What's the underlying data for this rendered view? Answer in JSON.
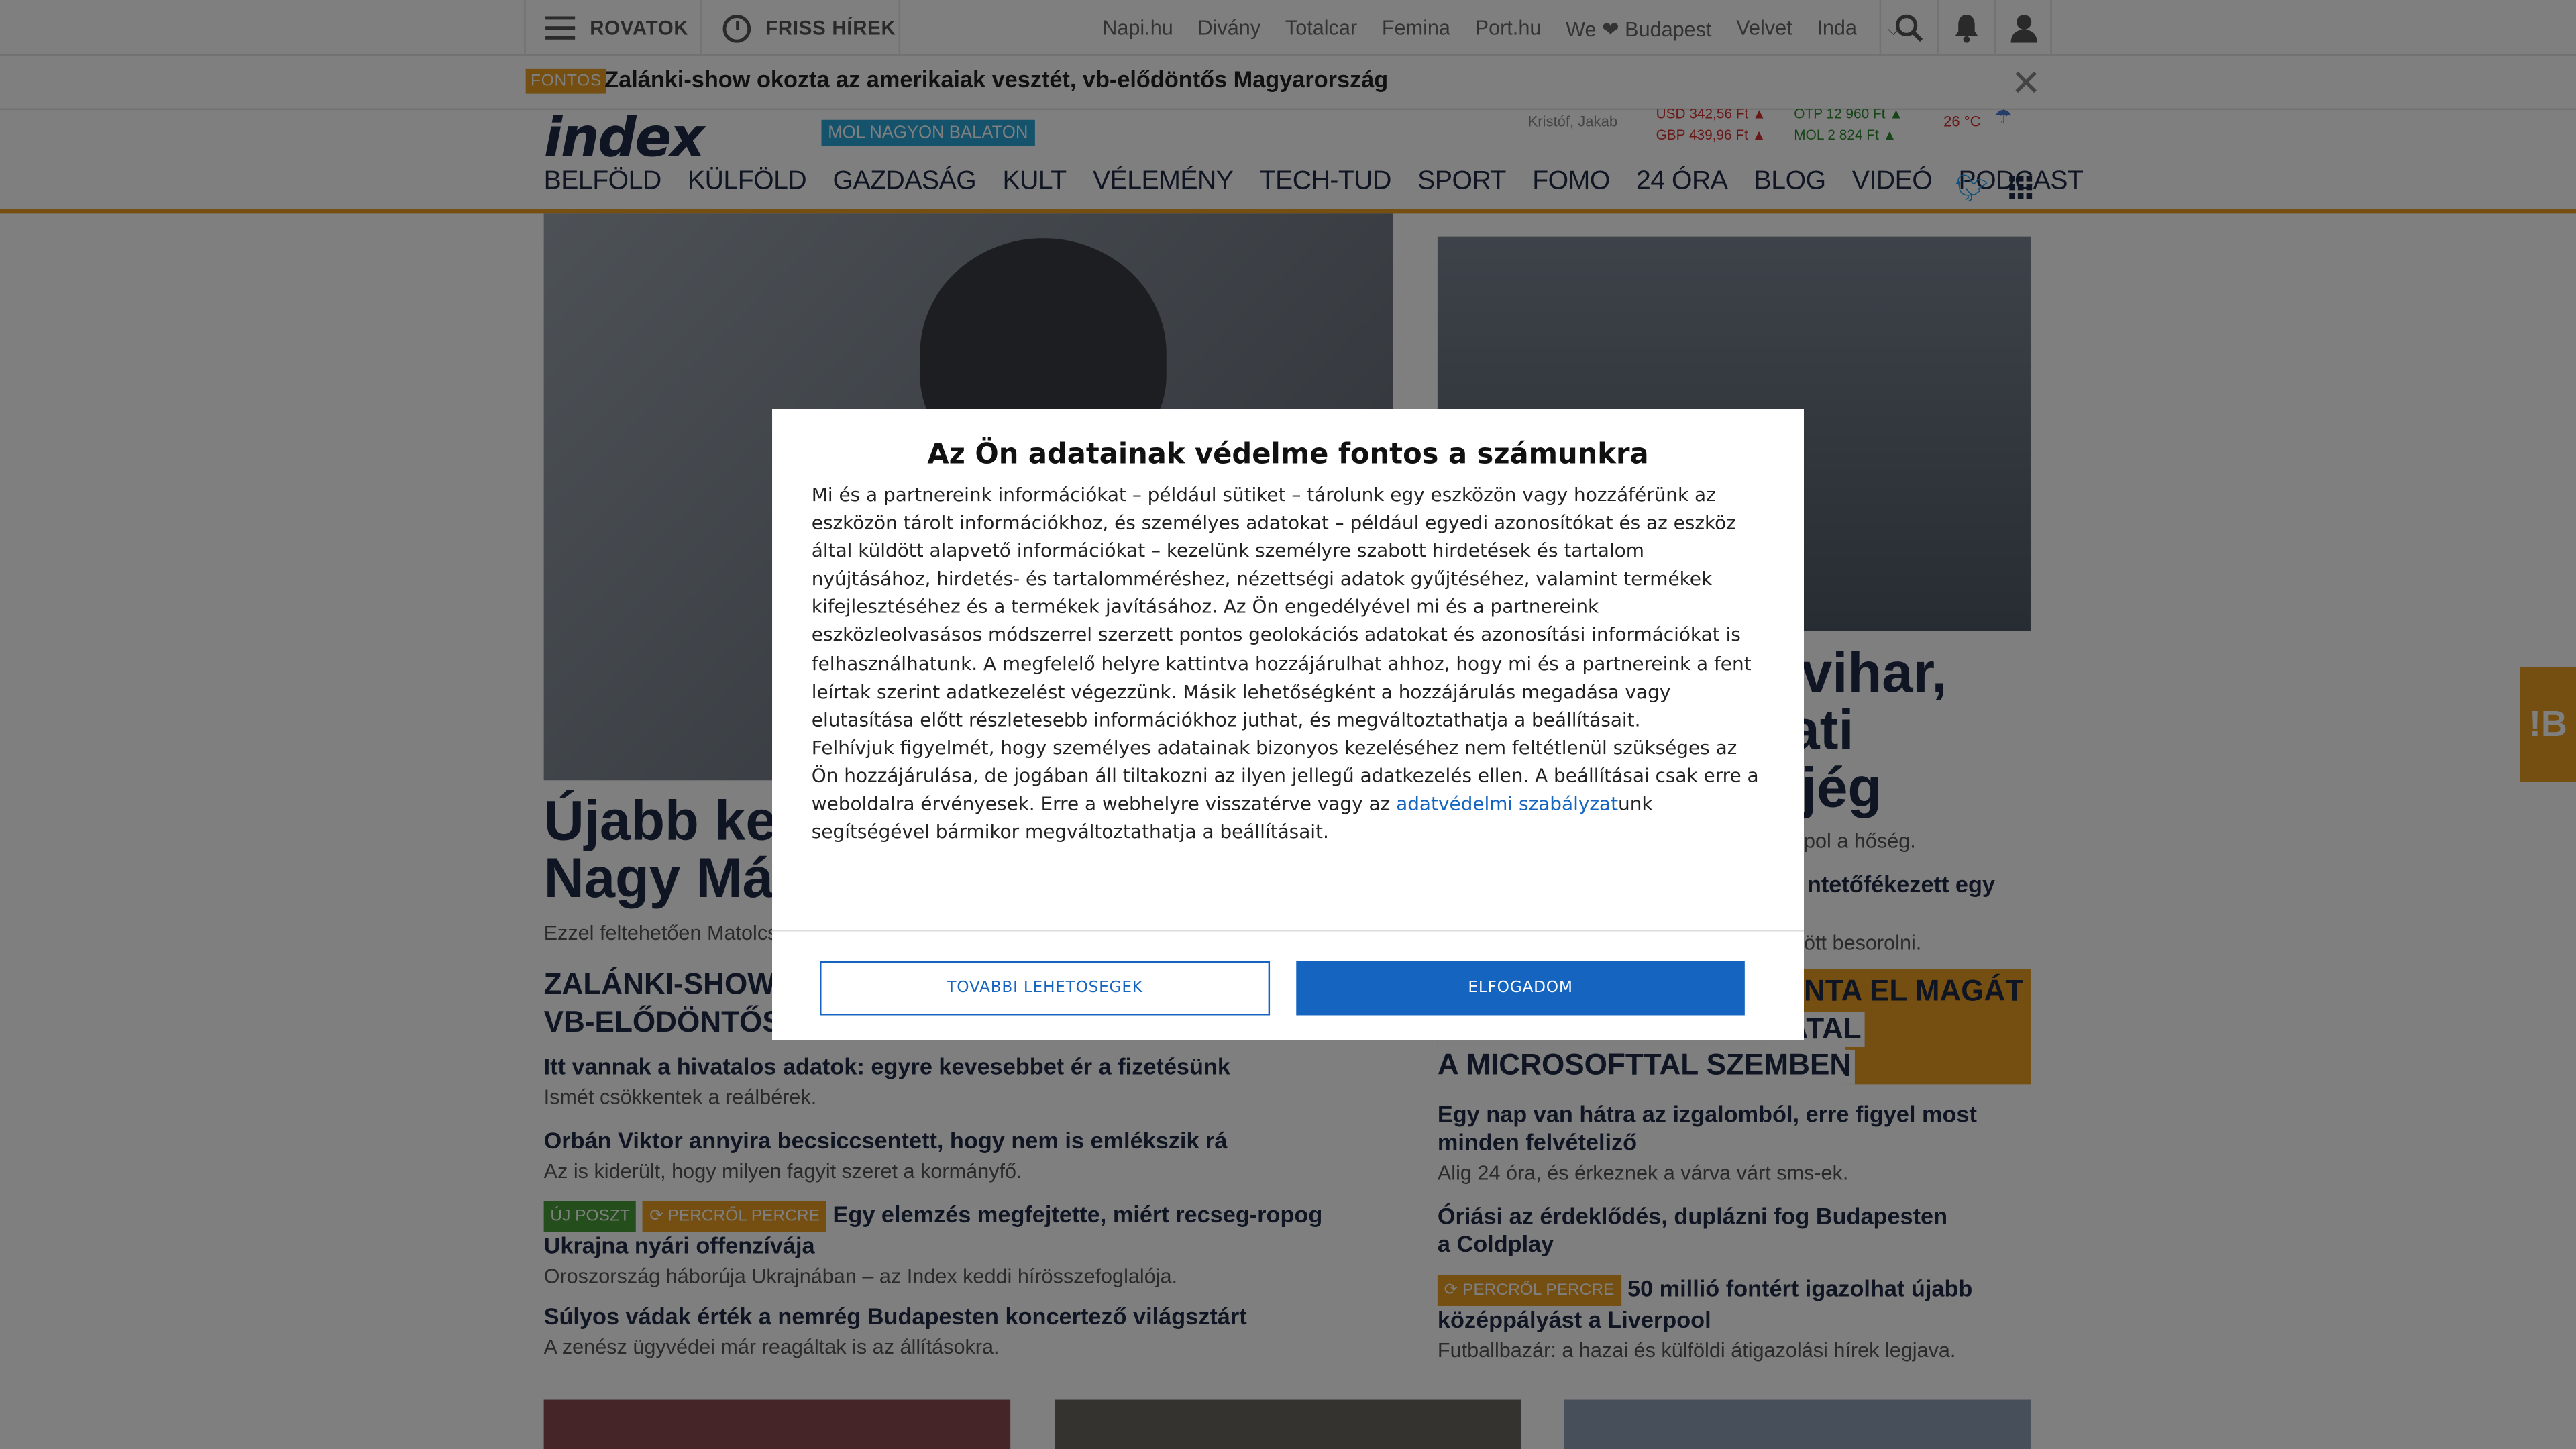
{
  "topbar": {
    "rovatok_label": "ROVATOK",
    "friss_label": "FRISS HÍREK",
    "sites": [
      "Napi.hu",
      "Divány",
      "Totalcar",
      "Femina",
      "Port.hu",
      "We ❤ Budapest",
      "Velvet",
      "Inda"
    ],
    "icons": [
      "search-icon",
      "bell-icon",
      "user-icon"
    ]
  },
  "breaking": {
    "badge": "FONTOS",
    "text": "Zalánki-show okozta az amerikaiak vesztét, vb-elődöntős Magyarország"
  },
  "header": {
    "logo": "index",
    "sponsor_badge": "MOL NAGYON BALATON",
    "author": "Kristóf, Jakab",
    "fx": {
      "usd": "USD 342,56 Ft",
      "gbp": "GBP 439,96 Ft",
      "utp": "OTP 12 960 Ft",
      "mol": "MOL 2 824 Ft"
    },
    "temperature": "26 °C"
  },
  "nav": {
    "items": [
      "BELFÖLD",
      "KÜLFÖLD",
      "GAZDASÁG",
      "KULT",
      "VÉLEMÉNY",
      "TECH-TUD",
      "SPORT",
      "FOMO",
      "24 ÓRA",
      "BLOG",
      "VIDEÓ",
      "PODCAST"
    ]
  },
  "content": {
    "hero_headline_line1": "Újabb ke",
    "hero_headline_line2": "Nagy Má",
    "hero_lead": "Ezzel feltehetően Matolcs",
    "right_headline_line1": "a vihar,",
    "right_headline_line2": "gati",
    "right_headline_line3": "a jég",
    "right_lead_1": "pol a hőség.",
    "right_article_partial": "ntetőfékezett egy",
    "right_lead_2": "ött besorolni.",
    "sub_head_line1": "ZALÁNKI-SHOW",
    "sub_head_line2": "VB-ELŐDÖNTŐS",
    "banner_line1": "NTA EL MAGÁT",
    "banner_line2": "VATAL",
    "banner_line3": "A MICROSOFTTAL SZEMBEN",
    "left_articles": [
      {
        "title": "Itt vannak a hivatalos adatok: egyre kevesebbet ér a fizetésünk",
        "desc": "Ismét csökkentek a reálbérek."
      },
      {
        "title": "Orbán Viktor annyira becsiccsentett, hogy nem is emlékszik rá",
        "desc": "Az is kiderült, hogy milyen fagyit szeret a kormányfő."
      },
      {
        "tag1": "ÚJ POSZT",
        "tag2": "PERCRŐL PERCRE",
        "title": "Egy elemzés megfejtette, miért recseg-ropog Ukrajna nyári offenzívája",
        "desc": "Oroszország háborúja Ukrajnában – az Index keddi hírösszefoglalója."
      },
      {
        "title": "Súlyos vádak érték a nemrég Budapesten koncertező világsztárt",
        "desc": "A zenész ügyvédei már reagáltak is az állításokra."
      }
    ],
    "right_articles": [
      {
        "title": "Egy nap van hátra az izgalomból, erre figyel most minden felvételiző",
        "desc": "Alig 24 óra, és érkeznek a várva várt sms-ek."
      },
      {
        "title": "Óriási az érdeklődés, duplázni fog Budapesten a Coldplay",
        "desc": ""
      },
      {
        "tag": "PERCRŐL PERCRE",
        "title": "50 millió fontért igazolhat újabb középpályást a Liverpool",
        "desc": "Futballbazár: a hazai és külföldi átigazolási hírek legjava."
      }
    ],
    "side_widget": "!B"
  },
  "consent": {
    "title": "Az Ön adatainak védelme fontos a számunkra",
    "body_p1": "Mi és a partnereink információkat – például sütiket – tárolunk egy eszközön vagy hozzáférünk az eszközön tárolt információkhoz, és személyes adatokat – például egyedi azonosítókat és az eszköz által küldött alapvető információkat – kezelünk személyre szabott hirdetések és tartalom nyújtásához, hirdetés- és tartalomméréshez, nézettségi adatok gyűjtéséhez, valamint termékek kifejlesztéséhez és a termékek javításához. Az Ön engedélyével mi és a partnereink eszközleolvasásos módszerrel szerzett pontos geolokációs adatokat és azonosítási információkat is felhasználhatunk. A megfelelő helyre kattintva hozzájárulhat ahhoz, hogy mi és a partnereink a fent leírtak szerint adatkezelést végezzünk. Másik lehetőségként a hozzájárulás megadása vagy elutasítása előtt részletesebb információkhoz juthat, és megváltoztathatja a beállításait.",
    "body_p2_before": "Felhívjuk figyelmét, hogy személyes adatainak bizonyos kezeléséhez nem feltétlenül szükséges az Ön hozzájárulása, de jogában áll tiltakozni az ilyen jellegű adatkezelés ellen. A beállításai csak erre a weboldalra érvényesek. Erre a webhelyre visszatérve vagy az ",
    "body_link": "adatvédelmi szabályzat",
    "body_p2_after": "unk segítségével bármikor megváltoztathatja a beállításait.",
    "more_button": "TOVABBI LEHETOSEGEK",
    "accept_button": "ELFOGADOM"
  },
  "colors": {
    "accent": "#e89e22",
    "brand_navy": "#1f2a44",
    "consent_blue": "#1565c0"
  }
}
